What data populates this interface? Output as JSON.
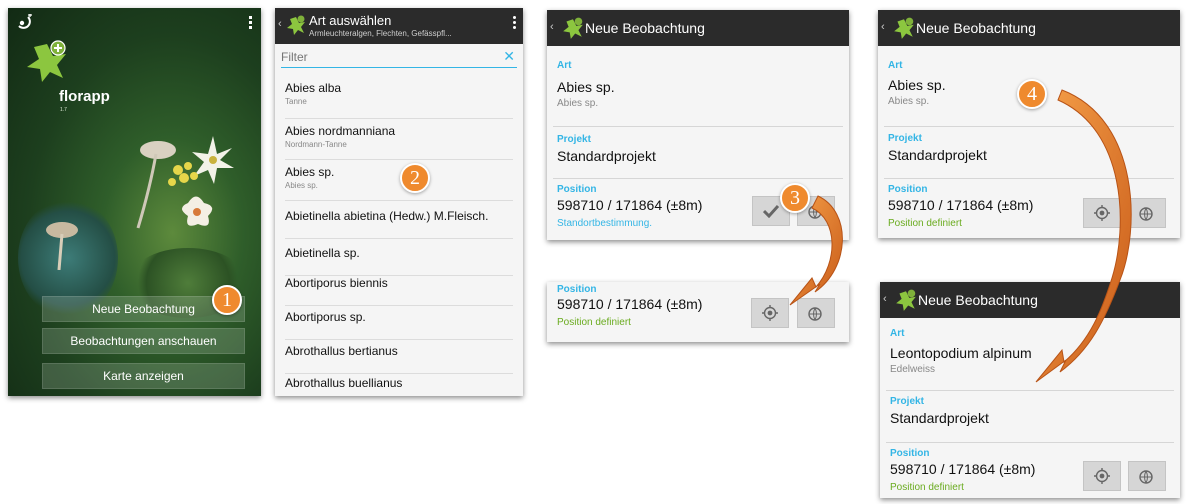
{
  "home": {
    "app_name": "florapp",
    "version": "1.7",
    "buttons": [
      "Neue Beobachtung",
      "Beobachtungen anschauen",
      "Karte anzeigen"
    ]
  },
  "species_list": {
    "title": "Art auswählen",
    "subtitle": "Armleuchteralgen, Flechten, Gefässpfl...",
    "filter_placeholder": "Filter",
    "items": [
      {
        "name": "Abies alba",
        "common": "Tanne"
      },
      {
        "name": "Abies nordmanniana",
        "common": "Nordmann-Tanne"
      },
      {
        "name": "Abies sp.",
        "common": "Abies sp."
      },
      {
        "name": "Abietinella abietina (Hedw.) M.Fleisch.",
        "common": ""
      },
      {
        "name": "Abietinella sp.",
        "common": ""
      },
      {
        "name": "Abortiporus biennis",
        "common": ""
      },
      {
        "name": "Abortiporus sp.",
        "common": ""
      },
      {
        "name": "Abrothallus bertianus",
        "common": ""
      },
      {
        "name": "Abrothallus buellianus",
        "common": ""
      }
    ]
  },
  "observation": {
    "title": "Neue Beobachtung",
    "art_label": "Art",
    "projekt_label": "Projekt",
    "position_label": "Position",
    "species_1": "Abies sp.",
    "species_1_sub": "Abies sp.",
    "species_2": "Leontopodium alpinum",
    "species_2_sub": "Edelweiss",
    "project": "Standardprojekt",
    "coords": "598710 / 171864 (±8m)",
    "status_locating": "Standortbestimmung.",
    "status_defined": "Position definiert"
  },
  "steps": [
    "1",
    "2",
    "3",
    "4"
  ],
  "colors": {
    "accent": "#33b5e5",
    "badge": "#ef8a2e",
    "green": "#6aab1f",
    "actionbar": "#2b2b2b"
  }
}
